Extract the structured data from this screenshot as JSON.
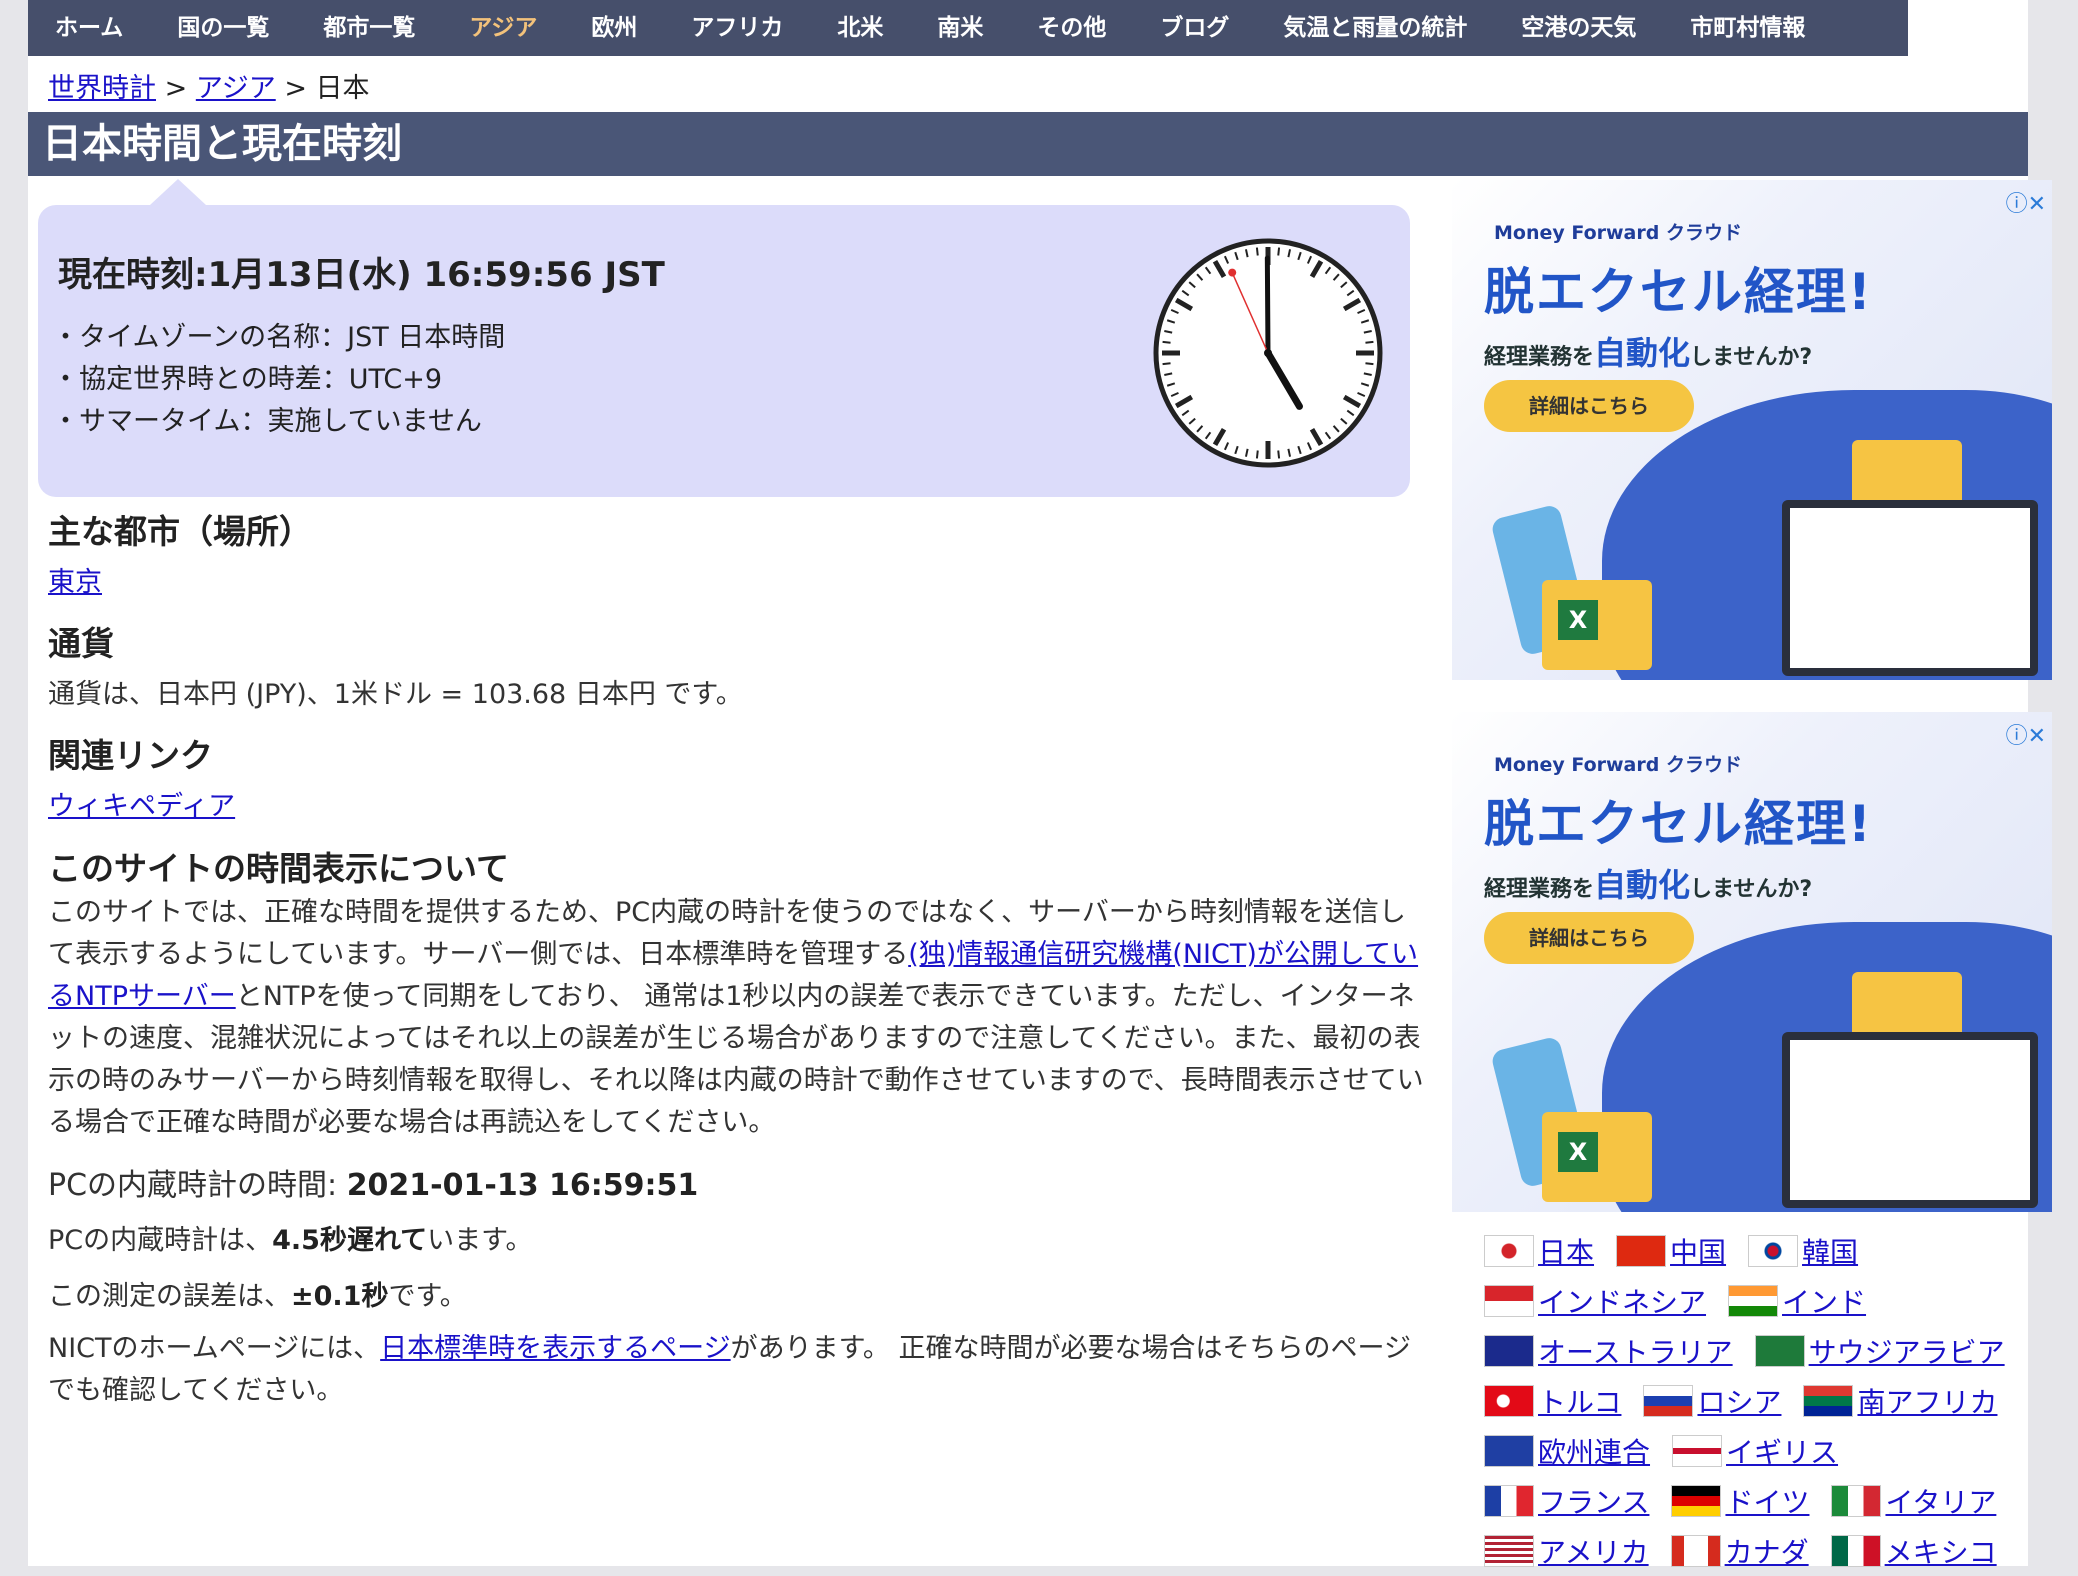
{
  "nav": [
    {
      "label": "ホーム",
      "active": false
    },
    {
      "label": "国の一覧",
      "active": false
    },
    {
      "label": "都市一覧",
      "active": false
    },
    {
      "label": "アジア",
      "active": true
    },
    {
      "label": "欧州",
      "active": false
    },
    {
      "label": "アフリカ",
      "active": false
    },
    {
      "label": "北米",
      "active": false
    },
    {
      "label": "南米",
      "active": false
    },
    {
      "label": "その他",
      "active": false
    },
    {
      "label": "ブログ",
      "active": false
    },
    {
      "label": "気温と雨量の統計",
      "active": false
    },
    {
      "label": "空港の天気",
      "active": false
    },
    {
      "label": "市町村情報",
      "active": false
    }
  ],
  "breadcrumb": {
    "home": "世界時計",
    "sep": ">",
    "region": "アジア",
    "current": "日本"
  },
  "title": "日本時間と現在時刻",
  "clock": {
    "now": "現在時刻:1月13日(水) 16:59:56 JST",
    "items": [
      "・タイムゾーンの名称：JST 日本時間",
      "・協定世界時との時差：UTC+9",
      "・サマータイム：実施していません"
    ],
    "hours": 16,
    "minutes": 59,
    "seconds": 56
  },
  "cities": {
    "heading": "主な都市（場所）",
    "link": "東京"
  },
  "currency": {
    "heading": "通貨",
    "text": "通貨は、日本円 (JPY)、1米ドル = 103.68 日本円 です。"
  },
  "related": {
    "heading": "関連リンク",
    "link": "ウィキペディア"
  },
  "about": {
    "heading": "このサイトの時間表示について",
    "p1_a": "このサイトでは、正確な時間を提供するため、PC内蔵の時計を使うのではなく、サーバーから時刻情報を送信して表示するようにしています。サーバー側では、日本標準時を管理する",
    "p1_link": "(独)情報通信研究機構(NICT)が公開しているNTPサーバー",
    "p1_b": "とNTPを使って同期をしており、 通常は1秒以内の誤差で表示できています。ただし、インターネットの速度、混雑状況によってはそれ以上の誤差が生じる場合がありますので注意してください。また、最初の表示の時のみサーバーから時刻情報を取得し、それ以降は内蔵の時計で動作させていますので、長時間表示させている場合で正確な時間が必要な場合は再読込をしてください。",
    "pc_time_label": "PCの内蔵時計の時間: ",
    "pc_time_value": "2021-01-13 16:59:51",
    "delay_a": "PCの内蔵時計は、",
    "delay_b": "4.5秒遅れて",
    "delay_c": "います。",
    "err_a": "この測定の誤差は、",
    "err_b": "±0.1秒",
    "err_c": "です。",
    "nict_a": "NICTのホームページには、",
    "nict_link": "日本標準時を表示するページ",
    "nict_b": "があります。 正確な時間が必要な場合はそちらのページでも確認してください。"
  },
  "ad": {
    "brand": "Money Forward クラウド",
    "headline": "脱エクセル経理!",
    "sub_a": "経理業務を",
    "sub_b": "自動化",
    "sub_c": "しませんか?",
    "button": "詳細はこちら",
    "excel": "X",
    "info": "ⓘ✕"
  },
  "countries": [
    [
      {
        "name": "日本",
        "flag": "jp"
      },
      {
        "name": "中国",
        "flag": "cn"
      },
      {
        "name": "韓国",
        "flag": "kr"
      }
    ],
    [
      {
        "name": "インドネシア",
        "flag": "id"
      },
      {
        "name": "インド",
        "flag": "in"
      }
    ],
    [
      {
        "name": "オーストラリア",
        "flag": "au"
      },
      {
        "name": "サウジアラビア",
        "flag": "sa"
      }
    ],
    [
      {
        "name": "トルコ",
        "flag": "tr"
      },
      {
        "name": "ロシア",
        "flag": "ru"
      },
      {
        "name": "南アフリカ",
        "flag": "za"
      }
    ],
    [
      {
        "name": " 欧州連合",
        "flag": "eu"
      },
      {
        "name": "イギリス",
        "flag": "gb"
      }
    ],
    [
      {
        "name": "フランス",
        "flag": "fr"
      },
      {
        "name": "ドイツ",
        "flag": "de"
      },
      {
        "name": "イタリア",
        "flag": "it"
      }
    ],
    [
      {
        "name": " アメリカ",
        "flag": "us"
      },
      {
        "name": "カナダ",
        "flag": "ca"
      },
      {
        "name": "メキシコ",
        "flag": "mx"
      }
    ]
  ],
  "colors": {
    "nav_bg": "#464f6b",
    "title_bg": "#4a5677",
    "clock_box": "#dcdcfa",
    "link": "#1a12c9",
    "active_nav": "#f3c27b"
  }
}
